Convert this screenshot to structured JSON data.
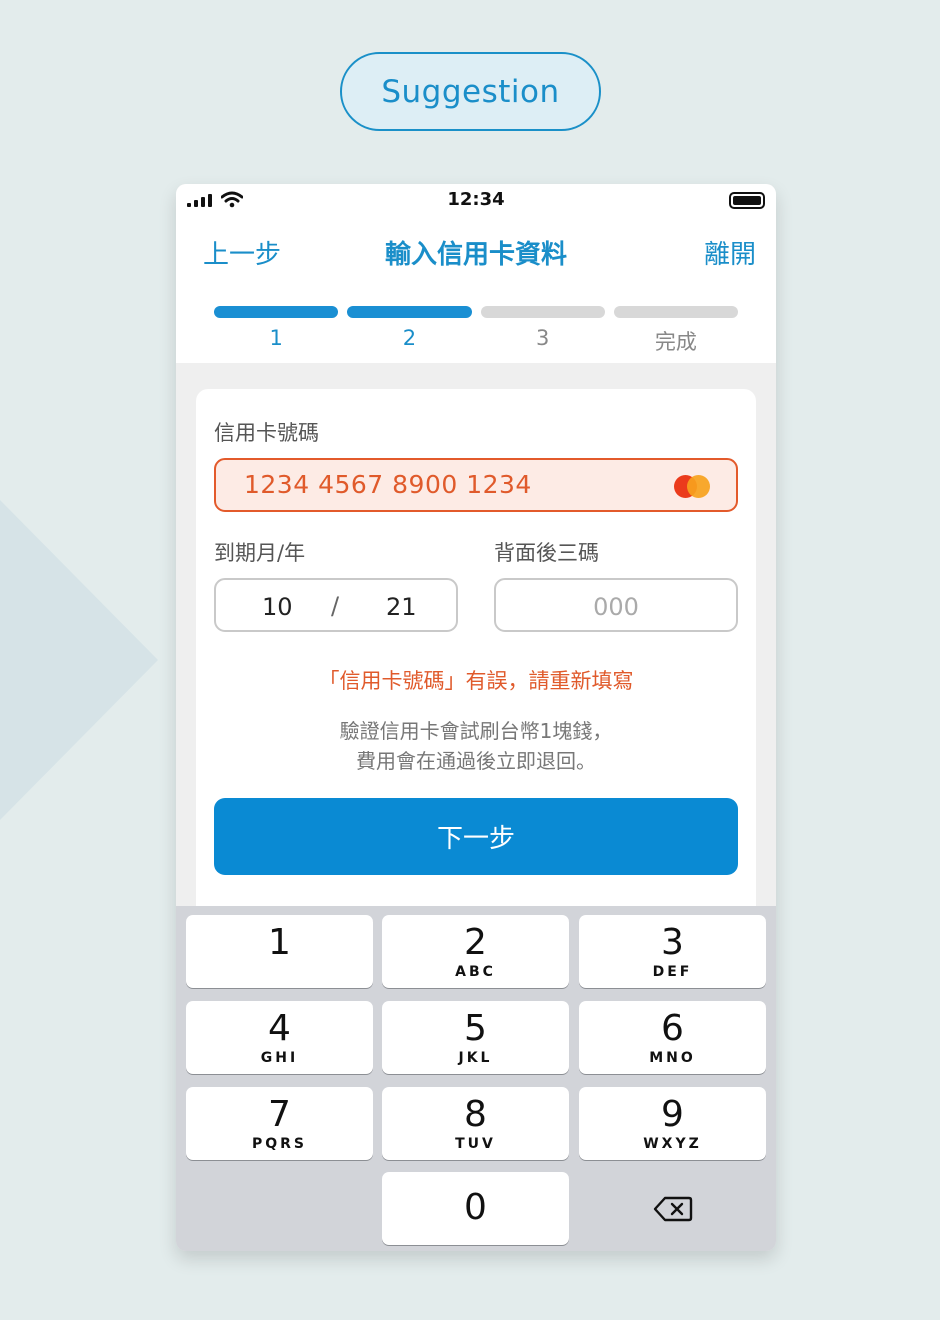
{
  "chip_label": "Suggestion",
  "status": {
    "time": "12:34"
  },
  "nav": {
    "back": "上一步",
    "title": "輸入信用卡資料",
    "exit": "離開"
  },
  "steps": [
    {
      "label": "1",
      "active": true
    },
    {
      "label": "2",
      "active": true
    },
    {
      "label": "3",
      "active": false
    },
    {
      "label": "完成",
      "active": false
    }
  ],
  "form": {
    "card_number_label": "信用卡號碼",
    "card_number_value": "1234 4567 8900 1234",
    "card_brand_icon": "mastercard-icon",
    "expiry_label": "到期月/年",
    "expiry_month": "10",
    "expiry_separator": "/",
    "expiry_year": "21",
    "cvv_label": "背面後三碼",
    "cvv_placeholder": "000",
    "error": "「信用卡號碼」有誤，請重新填寫",
    "note_line1": "驗證信用卡會試刷台幣1塊錢，",
    "note_line2": "費用會在通過後立即退回。",
    "next_button": "下一步"
  },
  "colors": {
    "accent": "#1a8fd3",
    "error": "#e05a2b",
    "background": "#e3ecec"
  },
  "keypad": [
    {
      "digit": "1",
      "letters": ""
    },
    {
      "digit": "2",
      "letters": "ABC"
    },
    {
      "digit": "3",
      "letters": "DEF"
    },
    {
      "digit": "4",
      "letters": "GHI"
    },
    {
      "digit": "5",
      "letters": "JKL"
    },
    {
      "digit": "6",
      "letters": "MNO"
    },
    {
      "digit": "7",
      "letters": "PQRS"
    },
    {
      "digit": "8",
      "letters": "TUV"
    },
    {
      "digit": "9",
      "letters": "WXYZ"
    },
    {
      "digit": "0",
      "letters": ""
    }
  ]
}
